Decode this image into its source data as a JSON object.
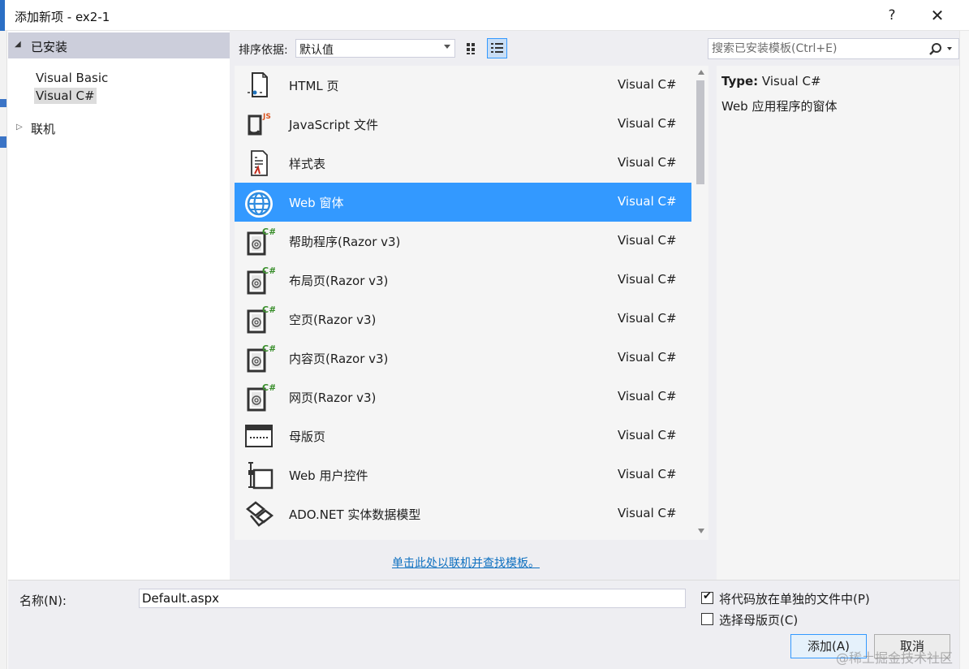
{
  "window": {
    "title": "添加新项 - ex2-1",
    "help_label": "?",
    "close_label": "✕"
  },
  "tree": {
    "installed_label": "已安装",
    "items": [
      "Visual Basic",
      "Visual C#"
    ],
    "selected": "Visual C#",
    "online_label": "联机"
  },
  "toolbar": {
    "sort_label": "排序依据:",
    "sort_value": "默认值",
    "search_placeholder": "搜索已安装模板(Ctrl+E)"
  },
  "templates": [
    {
      "name": "HTML 页",
      "lang": "Visual C#",
      "icon": "html-page-icon"
    },
    {
      "name": "JavaScript 文件",
      "lang": "Visual C#",
      "icon": "javascript-file-icon"
    },
    {
      "name": "样式表",
      "lang": "Visual C#",
      "icon": "stylesheet-icon"
    },
    {
      "name": "Web 窗体",
      "lang": "Visual C#",
      "icon": "globe-icon",
      "selected": true
    },
    {
      "name": "帮助程序(Razor v3)",
      "lang": "Visual C#",
      "icon": "razor-icon"
    },
    {
      "name": "布局页(Razor v3)",
      "lang": "Visual C#",
      "icon": "razor-icon"
    },
    {
      "name": "空页(Razor v3)",
      "lang": "Visual C#",
      "icon": "razor-icon"
    },
    {
      "name": "内容页(Razor v3)",
      "lang": "Visual C#",
      "icon": "razor-icon"
    },
    {
      "name": "网页(Razor v3)",
      "lang": "Visual C#",
      "icon": "razor-icon"
    },
    {
      "name": "母版页",
      "lang": "Visual C#",
      "icon": "master-page-icon"
    },
    {
      "name": "Web 用户控件",
      "lang": "Visual C#",
      "icon": "user-control-icon"
    },
    {
      "name": "ADO.NET 实体数据模型",
      "lang": "Visual C#",
      "icon": "entity-model-icon"
    }
  ],
  "online_link": "单击此处以联机并查找模板。",
  "details": {
    "type_label": "Type:",
    "type_value": "Visual C#",
    "description": "Web 应用程序的窗体"
  },
  "footer": {
    "name_label": "名称(N):",
    "name_value": "Default.aspx",
    "checkbox_separate": {
      "label": "将代码放在单独的文件中(P)",
      "checked": true
    },
    "checkbox_master": {
      "label": "选择母版页(C)",
      "checked": false
    },
    "add_label": "添加(A)",
    "cancel_label": "取消"
  },
  "watermark": "@稀土掘金技术社区",
  "colors": {
    "selection": "#3399ff",
    "link": "#0e70c0",
    "tree_header": "#cccedb"
  }
}
